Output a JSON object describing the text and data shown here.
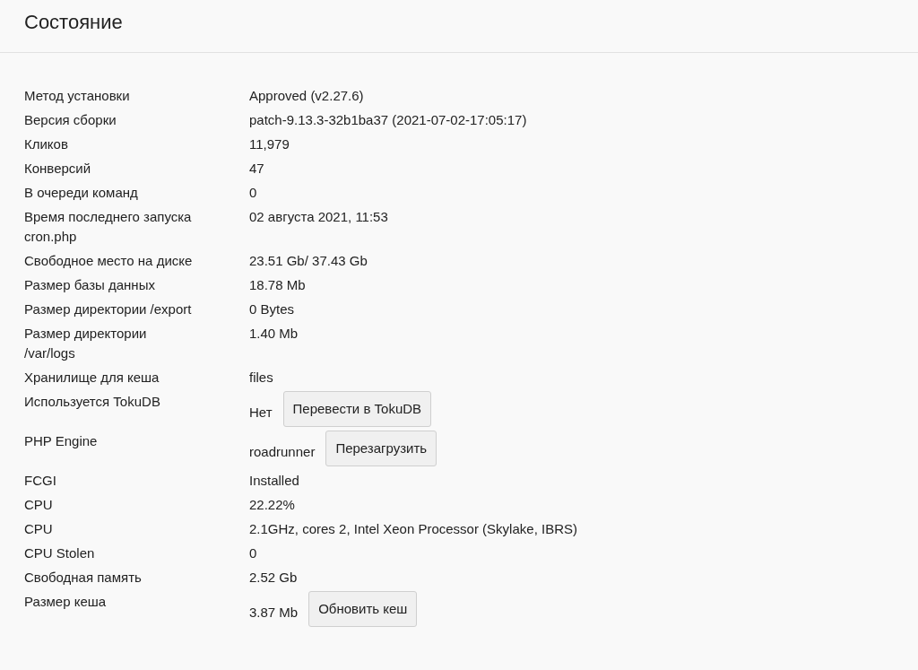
{
  "title": "Состояние",
  "rows": [
    {
      "kind": "text",
      "label": "Метод установки",
      "value": "Approved (v2.27.6)"
    },
    {
      "kind": "text",
      "label": "Версия сборки",
      "value": "patch-9.13.3-32b1ba37 (2021-07-02-17:05:17)"
    },
    {
      "kind": "text",
      "label": "Кликов",
      "value": "11,979"
    },
    {
      "kind": "text",
      "label": "Конверсий",
      "value": "47"
    },
    {
      "kind": "text",
      "label": "В очереди команд",
      "value": "0"
    },
    {
      "kind": "text",
      "label": "Время последнего запуска\ncron.php",
      "value": "02 августа 2021, 11:53"
    },
    {
      "kind": "text",
      "label": "Свободное место на диске",
      "value": "23.51 Gb/ 37.43 Gb"
    },
    {
      "kind": "text",
      "label": "Размер базы данных",
      "value": "18.78 Mb"
    },
    {
      "kind": "text",
      "label": "Размер директории /export",
      "value": "0 Bytes"
    },
    {
      "kind": "text",
      "label": "Размер директории\n/var/logs",
      "value": "1.40 Mb"
    },
    {
      "kind": "text",
      "label": "Хранилище для кеша",
      "value": "files"
    },
    {
      "kind": "button",
      "label": "Используется TokuDB",
      "value": "Нет",
      "button": "Перевести в TokuDB"
    },
    {
      "kind": "button",
      "label": "PHP Engine",
      "value": "roadrunner",
      "button": "Перезагрузить"
    },
    {
      "kind": "text",
      "label": "FCGI",
      "value": "Installed"
    },
    {
      "kind": "text",
      "label": "CPU",
      "value": "22.22%"
    },
    {
      "kind": "text",
      "label": "CPU",
      "value": "2.1GHz, cores 2, Intel Xeon Processor (Skylake, IBRS)"
    },
    {
      "kind": "text",
      "label": "CPU Stolen",
      "value": "0"
    },
    {
      "kind": "text",
      "label": "Свободная память",
      "value": "2.52 Gb"
    },
    {
      "kind": "button",
      "label": "Размер кеша",
      "value": "3.87 Mb",
      "button": "Обновить кеш"
    }
  ]
}
